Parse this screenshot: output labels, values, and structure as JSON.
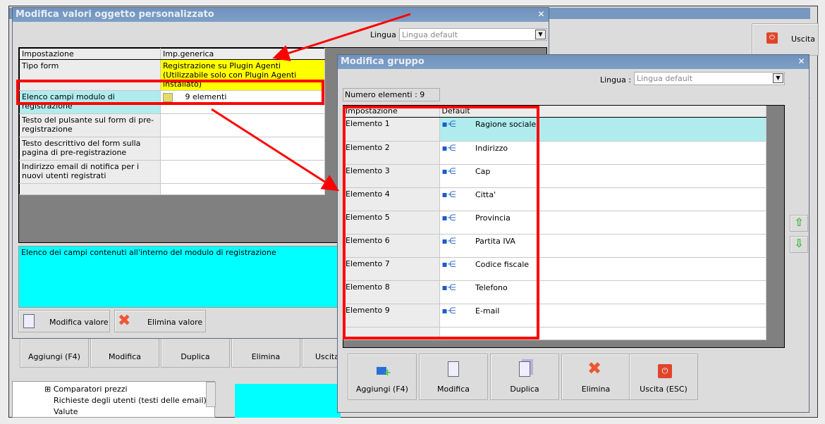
{
  "background_app": {
    "exit_label": "Uscita",
    "toolbar": [
      "Aggiungi (F4)",
      "Modifica",
      "Duplica",
      "Elimina",
      "Uscita"
    ],
    "tree": [
      "Comparatori prezzi",
      "Richieste degli utenti (testi delle email)",
      "Valute"
    ]
  },
  "dialog1": {
    "title": "Modifica valori oggetto personalizzato",
    "lingua_label": "Lingua :",
    "lingua_value": "Lingua default",
    "headers": [
      "Impostazione",
      "Imp.generica"
    ],
    "rows": [
      {
        "setting": "Tipo form",
        "value": "Registrazione su Plugin Agenti (Utilizzabile solo con Plugin Agenti installato)"
      },
      {
        "setting": "Elenco campi modulo di registrazione",
        "value": "9 elementi"
      },
      {
        "setting": "Testo del pulsante sul form di pre-registrazione",
        "value": ""
      },
      {
        "setting": "Testo descrittivo del form sulla pagina di pre-registrazione",
        "value": ""
      },
      {
        "setting": "Indirizzo email di notifica per i nuovi utenti registrati",
        "value": ""
      }
    ],
    "description": "Elenco dei campi contenuti all'interno del modulo di registrazione",
    "buttons": {
      "edit": "Modifica valore",
      "delete": "Elimina valore"
    }
  },
  "dialog2": {
    "title": "Modifica gruppo",
    "lingua_label": "Lingua :",
    "lingua_value": "Lingua default",
    "count": "Numero elementi : 9",
    "headers": [
      "Impostazione",
      "Default"
    ],
    "rows": [
      {
        "setting": "Elemento 1",
        "value": "Ragione sociale"
      },
      {
        "setting": "Elemento 2",
        "value": "Indirizzo"
      },
      {
        "setting": "Elemento 3",
        "value": "Cap"
      },
      {
        "setting": "Elemento 4",
        "value": "Citta'"
      },
      {
        "setting": "Elemento 5",
        "value": "Provincia"
      },
      {
        "setting": "Elemento 6",
        "value": "Partita IVA"
      },
      {
        "setting": "Elemento 7",
        "value": "Codice fiscale"
      },
      {
        "setting": "Elemento 8",
        "value": "Telefono"
      },
      {
        "setting": "Elemento 9",
        "value": "E-mail"
      }
    ],
    "buttons": [
      "Aggiungi (F4)",
      "Modifica",
      "Duplica",
      "Elimina",
      "Uscita (ESC)"
    ]
  },
  "colors": {
    "selected_row": "#b0ecee",
    "highlight": "#ffff00",
    "description_bg": "#00ffff",
    "annotation": "#ff0000"
  }
}
